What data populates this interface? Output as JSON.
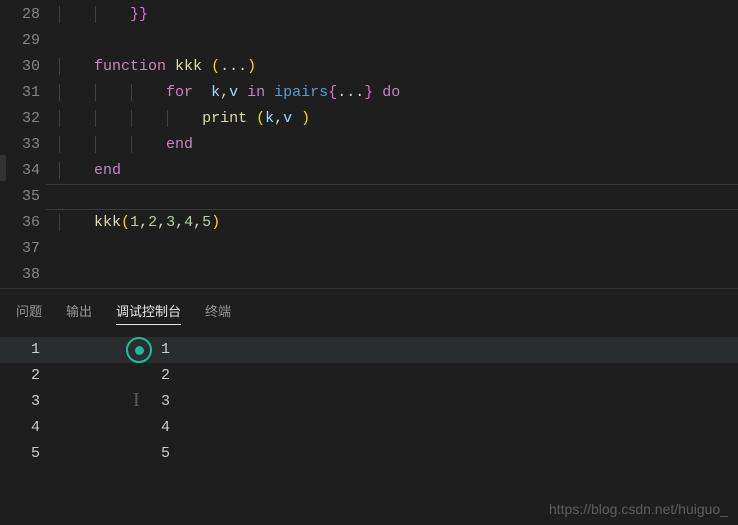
{
  "code": {
    "lines": [
      {
        "n": "28",
        "indent": 2,
        "tokens": [
          {
            "t": "}}",
            "c": "tok-puncta"
          }
        ]
      },
      {
        "n": "29",
        "indent": 0,
        "tokens": []
      },
      {
        "n": "30",
        "indent": 1,
        "tokens": [
          {
            "t": "function",
            "c": "tok-keyword"
          },
          {
            "t": " ",
            "c": ""
          },
          {
            "t": "kkk",
            "c": "tok-func"
          },
          {
            "t": " ",
            "c": ""
          },
          {
            "t": "(",
            "c": "tok-punct2"
          },
          {
            "t": "...",
            "c": "tok-punct"
          },
          {
            "t": ")",
            "c": "tok-punct2"
          }
        ]
      },
      {
        "n": "31",
        "indent": 3,
        "tokens": [
          {
            "t": "for",
            "c": "tok-keyword"
          },
          {
            "t": "  ",
            "c": ""
          },
          {
            "t": "k",
            "c": "tok-var"
          },
          {
            "t": ",",
            "c": "tok-punct"
          },
          {
            "t": "v",
            "c": "tok-var"
          },
          {
            "t": " ",
            "c": ""
          },
          {
            "t": "in",
            "c": "tok-keyword"
          },
          {
            "t": " ",
            "c": ""
          },
          {
            "t": "ipairs",
            "c": "tok-func2"
          },
          {
            "t": "{",
            "c": "tok-puncta"
          },
          {
            "t": "...",
            "c": "tok-punct"
          },
          {
            "t": "}",
            "c": "tok-puncta"
          },
          {
            "t": " ",
            "c": ""
          },
          {
            "t": "do",
            "c": "tok-keyword"
          }
        ]
      },
      {
        "n": "32",
        "indent": 4,
        "tokens": [
          {
            "t": "print",
            "c": "tok-func"
          },
          {
            "t": " ",
            "c": ""
          },
          {
            "t": "(",
            "c": "tok-punct2"
          },
          {
            "t": "k",
            "c": "tok-var"
          },
          {
            "t": ",",
            "c": "tok-punct"
          },
          {
            "t": "v",
            "c": "tok-var"
          },
          {
            "t": " ",
            "c": ""
          },
          {
            "t": ")",
            "c": "tok-punct2"
          }
        ]
      },
      {
        "n": "33",
        "indent": 3,
        "tokens": [
          {
            "t": "end",
            "c": "tok-keyword"
          }
        ]
      },
      {
        "n": "34",
        "indent": 1,
        "tokens": [
          {
            "t": "end",
            "c": "tok-keyword"
          }
        ]
      },
      {
        "n": "35",
        "indent": 0,
        "tokens": [],
        "active": true
      },
      {
        "n": "36",
        "indent": 1,
        "tokens": [
          {
            "t": "kkk",
            "c": "tok-func"
          },
          {
            "t": "(",
            "c": "tok-punct2"
          },
          {
            "t": "1",
            "c": "tok-num"
          },
          {
            "t": ",",
            "c": "tok-punct"
          },
          {
            "t": "2",
            "c": "tok-num"
          },
          {
            "t": ",",
            "c": "tok-punct"
          },
          {
            "t": "3",
            "c": "tok-num"
          },
          {
            "t": ",",
            "c": "tok-punct"
          },
          {
            "t": "4",
            "c": "tok-num"
          },
          {
            "t": ",",
            "c": "tok-punct"
          },
          {
            "t": "5",
            "c": "tok-num"
          },
          {
            "t": ")",
            "c": "tok-punct2"
          }
        ]
      },
      {
        "n": "37",
        "indent": 0,
        "tokens": []
      },
      {
        "n": "38",
        "indent": 0,
        "tokens": []
      }
    ]
  },
  "panel": {
    "tabs": {
      "problems": "问题",
      "output": "输出",
      "debug_console": "调试控制台",
      "terminal": "终端"
    },
    "output": [
      {
        "a": "1",
        "b": "1",
        "hl": true,
        "cursor": true
      },
      {
        "a": "2",
        "b": "2"
      },
      {
        "a": "3",
        "b": "3",
        "textcursor": true
      },
      {
        "a": "4",
        "b": "4"
      },
      {
        "a": "5",
        "b": "5"
      }
    ]
  },
  "watermark": "https://blog.csdn.net/huiguo_"
}
